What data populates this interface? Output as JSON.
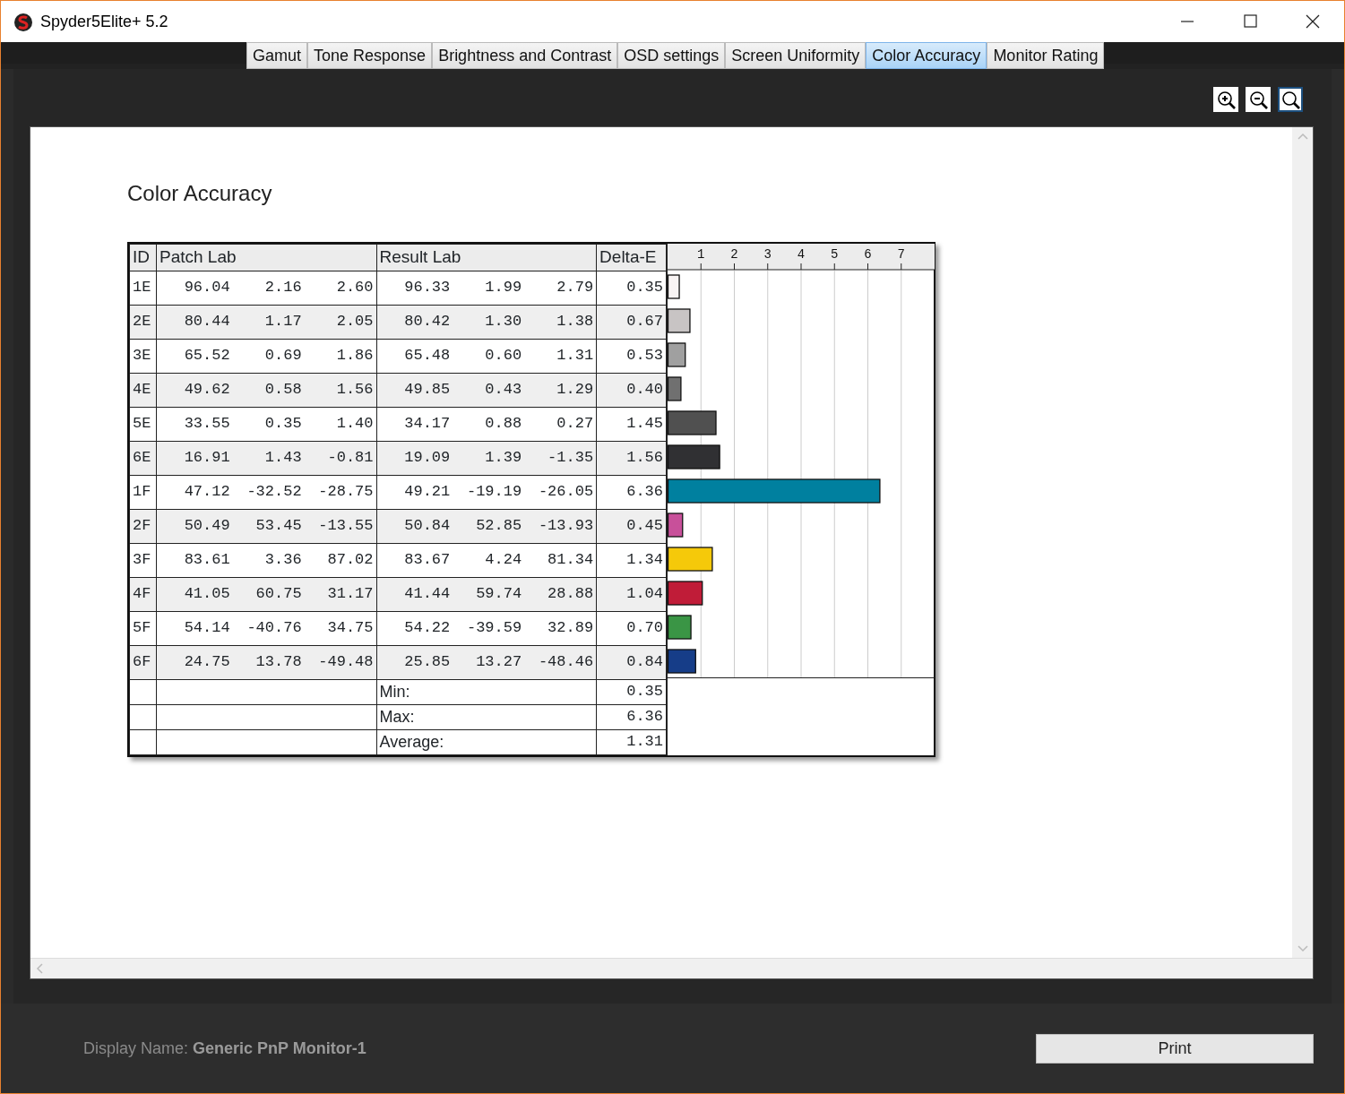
{
  "window": {
    "title": "Spyder5Elite+ 5.2"
  },
  "tabs": [
    {
      "label": "Gamut",
      "selected": false
    },
    {
      "label": "Tone Response",
      "selected": false
    },
    {
      "label": "Brightness and Contrast",
      "selected": false
    },
    {
      "label": "OSD settings",
      "selected": false
    },
    {
      "label": "Screen Uniformity",
      "selected": false
    },
    {
      "label": "Color Accuracy",
      "selected": true
    },
    {
      "label": "Monitor Rating",
      "selected": false
    }
  ],
  "zoom_tools": [
    {
      "kind": "zoom-in",
      "selected": false
    },
    {
      "kind": "zoom-out",
      "selected": false
    },
    {
      "kind": "zoom-fit",
      "selected": true
    }
  ],
  "report": {
    "title": "Color Accuracy",
    "table": {
      "columns": [
        "ID",
        "Patch Lab",
        "Result Lab",
        "Delta-E"
      ],
      "rows": [
        {
          "id": "1E",
          "patch": [
            "96.04",
            "2.16",
            "2.60"
          ],
          "result": [
            "96.33",
            "1.99",
            "2.79"
          ],
          "delta_e": "0.35",
          "color": "#f8f4f4"
        },
        {
          "id": "2E",
          "patch": [
            "80.44",
            "1.17",
            "2.05"
          ],
          "result": [
            "80.42",
            "1.30",
            "1.38"
          ],
          "delta_e": "0.67",
          "color": "#c8c4c4"
        },
        {
          "id": "3E",
          "patch": [
            "65.52",
            "0.69",
            "1.86"
          ],
          "result": [
            "65.48",
            "0.60",
            "1.31"
          ],
          "delta_e": "0.53",
          "color": "#a0a0a0"
        },
        {
          "id": "4E",
          "patch": [
            "49.62",
            "0.58",
            "1.56"
          ],
          "result": [
            "49.85",
            "0.43",
            "1.29"
          ],
          "delta_e": "0.40",
          "color": "#707070"
        },
        {
          "id": "5E",
          "patch": [
            "33.55",
            "0.35",
            "1.40"
          ],
          "result": [
            "34.17",
            "0.88",
            "0.27"
          ],
          "delta_e": "1.45",
          "color": "#505050"
        },
        {
          "id": "6E",
          "patch": [
            "16.91",
            "1.43",
            "-0.81"
          ],
          "result": [
            "19.09",
            "1.39",
            "-1.35"
          ],
          "delta_e": "1.56",
          "color": "#303033"
        },
        {
          "id": "1F",
          "patch": [
            "47.12",
            "-32.52",
            "-28.75"
          ],
          "result": [
            "49.21",
            "-19.19",
            "-26.05"
          ],
          "delta_e": "6.36",
          "color": "#00809f"
        },
        {
          "id": "2F",
          "patch": [
            "50.49",
            "53.45",
            "-13.55"
          ],
          "result": [
            "50.84",
            "52.85",
            "-13.93"
          ],
          "delta_e": "0.45",
          "color": "#c8509a"
        },
        {
          "id": "3F",
          "patch": [
            "83.61",
            "3.36",
            "87.02"
          ],
          "result": [
            "83.67",
            "4.24",
            "81.34"
          ],
          "delta_e": "1.34",
          "color": "#f5c90a"
        },
        {
          "id": "4F",
          "patch": [
            "41.05",
            "60.75",
            "31.17"
          ],
          "result": [
            "41.44",
            "59.74",
            "28.88"
          ],
          "delta_e": "1.04",
          "color": "#c01c38"
        },
        {
          "id": "5F",
          "patch": [
            "54.14",
            "-40.76",
            "34.75"
          ],
          "result": [
            "54.22",
            "-39.59",
            "32.89"
          ],
          "delta_e": "0.70",
          "color": "#3a9545"
        },
        {
          "id": "6F",
          "patch": [
            "24.75",
            "13.78",
            "-49.48"
          ],
          "result": [
            "25.85",
            "13.27",
            "-48.46"
          ],
          "delta_e": "0.84",
          "color": "#163d88"
        }
      ],
      "summary": [
        {
          "label": "Min:",
          "value": "0.35"
        },
        {
          "label": "Max:",
          "value": "6.36"
        },
        {
          "label": "Average:",
          "value": "1.31"
        }
      ],
      "chart_data": {
        "type": "bar",
        "orientation": "horizontal",
        "values": [
          0.35,
          0.67,
          0.53,
          0.4,
          1.45,
          1.56,
          6.36,
          0.45,
          1.34,
          1.04,
          0.7,
          0.84
        ],
        "xlim": [
          0,
          8
        ],
        "xticks": [
          1,
          2,
          3,
          4,
          5,
          6,
          7
        ],
        "grid": true
      }
    }
  },
  "footer": {
    "display_name_label": "Display Name:",
    "display_name": "Generic PnP Monitor-1",
    "print_button": "Print"
  }
}
